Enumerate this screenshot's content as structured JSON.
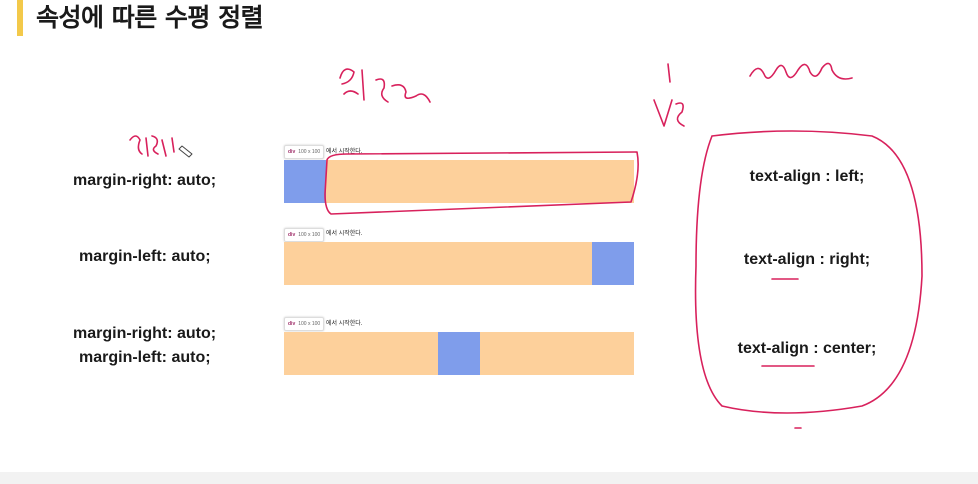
{
  "title": "속성에 따른 수평 정렬",
  "rows": [
    {
      "lines": [
        "margin-right: auto;"
      ],
      "tooltip_tag": "div",
      "tooltip_size": "100 x 100",
      "after_text": "에서 시작한다."
    },
    {
      "lines": [
        "margin-left: auto;"
      ],
      "tooltip_tag": "div",
      "tooltip_size": "100 x 100",
      "after_text": "에서 시작한다."
    },
    {
      "lines": [
        "margin-right: auto;",
        "margin-left: auto;"
      ],
      "tooltip_tag": "div",
      "tooltip_size": "100 x 100",
      "after_text": "에서 시작한다."
    }
  ],
  "text_align": [
    "text-align : left;",
    "text-align : right;",
    "text-align : center;"
  ],
  "colors": {
    "accent": "#f3c94a",
    "box_bg": "#fdd09b",
    "box_blue": "#7f9deb",
    "ink": "#d8215c"
  }
}
